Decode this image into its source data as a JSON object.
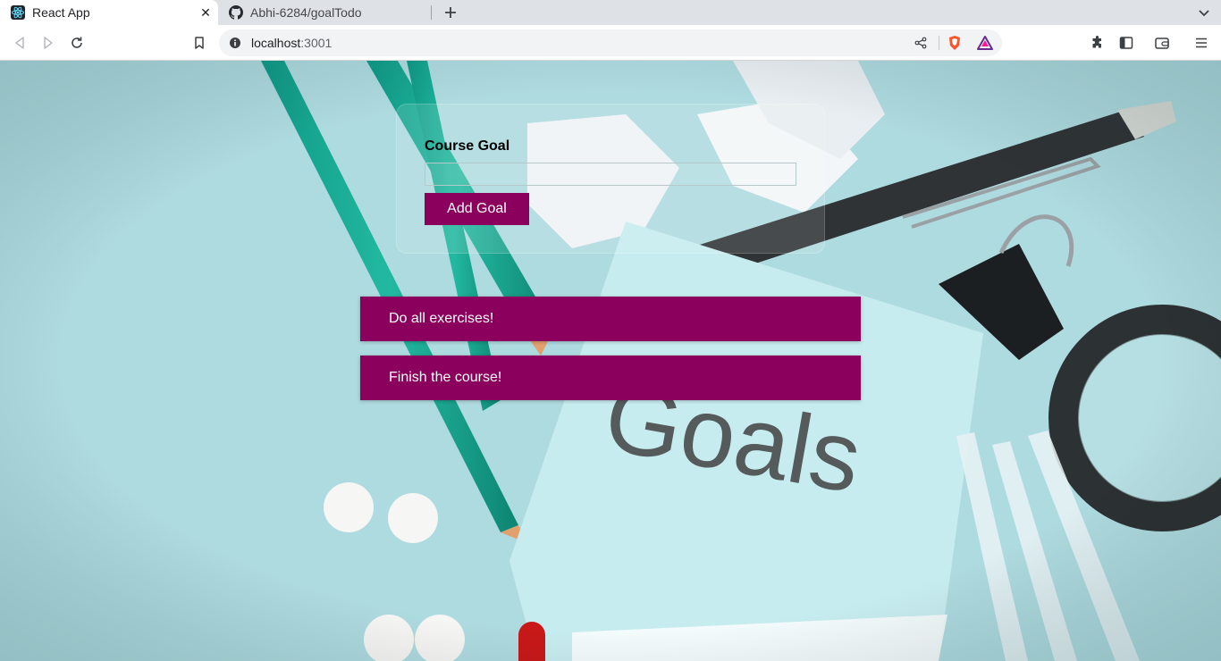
{
  "browser": {
    "tabs": [
      {
        "title": "React App",
        "active": true,
        "icon": "react-icon"
      },
      {
        "title": "Abhi-6284/goalTodo",
        "active": false,
        "icon": "github-icon"
      }
    ],
    "address": {
      "host": "localhost",
      "port": ":3001"
    }
  },
  "app": {
    "form": {
      "label": "Course Goal",
      "input_value": "",
      "button_label": "Add Goal"
    },
    "goals": [
      {
        "text": "Do all exercises!"
      },
      {
        "text": "Finish the course!"
      }
    ],
    "background_text": "Goals",
    "accent_color": "#8b005d"
  }
}
